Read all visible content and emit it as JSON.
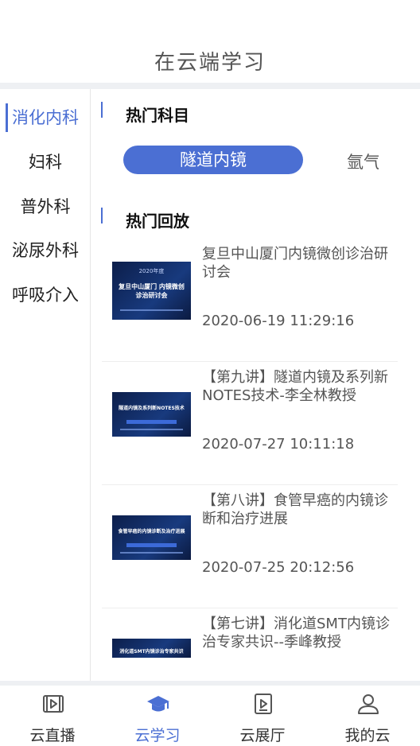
{
  "header": {
    "title": "在云端学习"
  },
  "sidebar": {
    "items": [
      {
        "label": "消化内科",
        "active": true
      },
      {
        "label": "妇科"
      },
      {
        "label": "普外科"
      },
      {
        "label": "泌尿外科"
      },
      {
        "label": "呼吸介入"
      }
    ]
  },
  "main": {
    "hot_subjects": {
      "title": "热门科目",
      "pills": [
        {
          "label": "隧道内镜",
          "active": true
        },
        {
          "label": "氩气"
        }
      ]
    },
    "hot_replays": {
      "title": "热门回放",
      "items": [
        {
          "title": "复旦中山厦门内镜微创诊治研讨会",
          "time": "2020-06-19 11:29:16",
          "thumb_top": "2020年度",
          "thumb_main": "复旦中山厦门 内镜微创诊治研讨会"
        },
        {
          "title": "【第九讲】隧道内镜及系列新NOTES技术-李全林教授",
          "time": "2020-07-27 10:11:18",
          "thumb_top": "",
          "thumb_main": "隧道内镜及系列新NOTES技术"
        },
        {
          "title": "【第八讲】食管早癌的内镜诊断和治疗进展",
          "time": "2020-07-25 20:12:56",
          "thumb_top": "",
          "thumb_main": "食管早癌的内镜诊断及治疗进展"
        },
        {
          "title": "【第七讲】消化道SMT内镜诊治专家共识--季峰教授",
          "time": "",
          "thumb_top": "",
          "thumb_main": "消化道SMT内镜诊治专家共识"
        }
      ]
    }
  },
  "tabbar": {
    "items": [
      {
        "label": "云直播",
        "icon": "live-video-icon"
      },
      {
        "label": "云学习",
        "icon": "graduation-cap-icon",
        "active": true
      },
      {
        "label": "云展厅",
        "icon": "exhibition-play-icon"
      },
      {
        "label": "我的云",
        "icon": "user-icon"
      }
    ]
  },
  "colors": {
    "accent": "#4b6fd3",
    "text": "#555555",
    "separator": "#eef0f3"
  }
}
